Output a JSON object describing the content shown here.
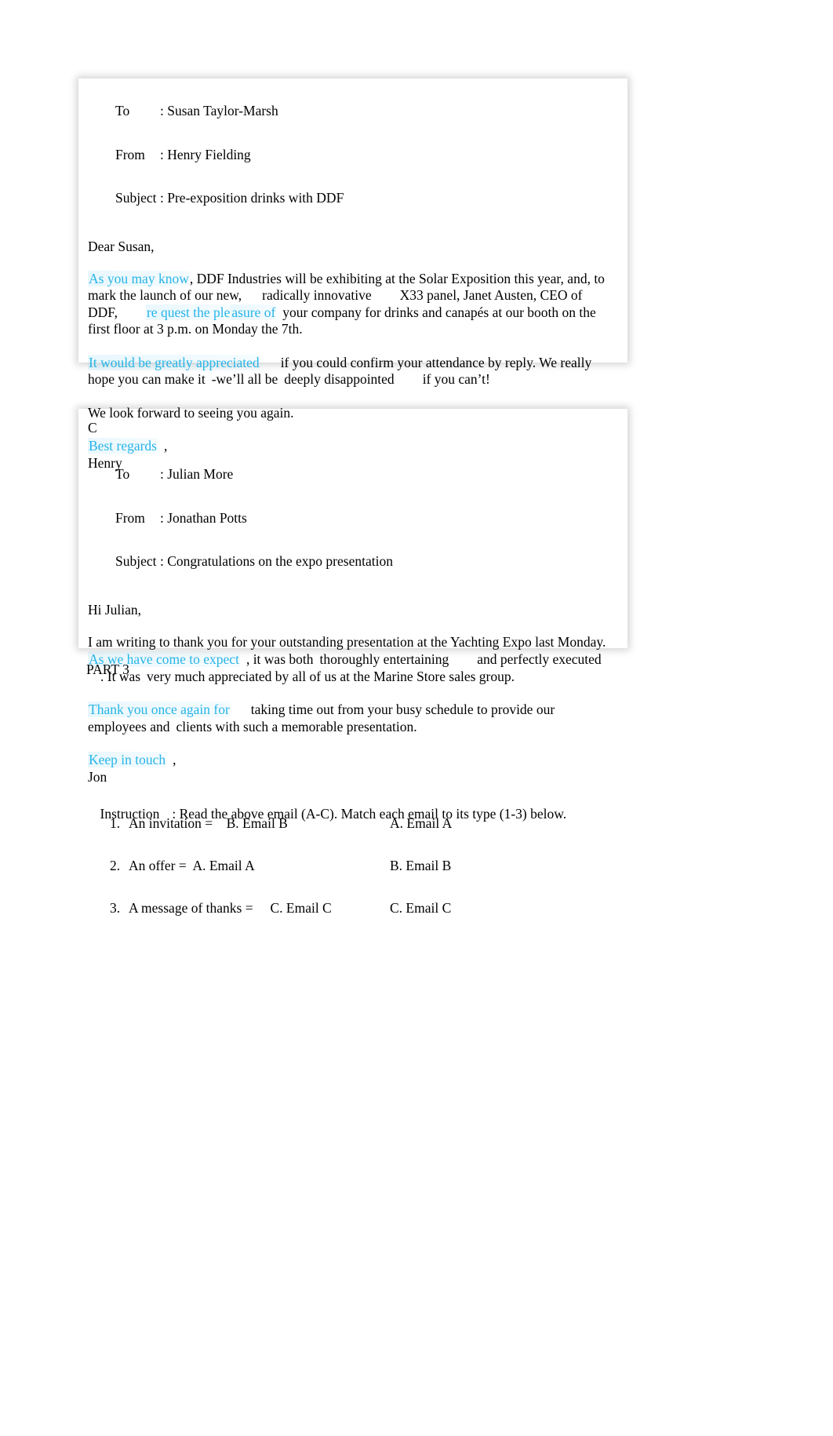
{
  "document": {
    "part_label": "PART 3",
    "instruction_label": "Instruction",
    "instruction_text": ": Read the above email (A-C). Match each email to its type (1-3) below."
  },
  "accent_color": "#27b4e8",
  "emails": [
    {
      "letter": "",
      "headers": [
        {
          "label": "To",
          "value": ": Susan Taylor-Marsh"
        },
        {
          "label": "From",
          "value": ": Henry Fielding"
        },
        {
          "label": "Subject",
          "value": ": Pre-exposition drinks with DDF"
        }
      ],
      "salutation": "Dear Susan,",
      "body": {
        "p1_hl1": "As  you may know",
        "p1_t1": ", DDF Industries will be exhibiting at the Solar Exposition this year, and, to mark t",
        "p1_t2": "he launch of our new,",
        "p1_t3": "radically innovative",
        "p1_t4": "X33 panel, Janet Austen, CEO of DDF,",
        "p1_hl2": "re quest the ple",
        "p1_hl3": "asure of",
        "p1_t5": "your company for drinks and canapés at our booth on the first floor at 3 p.m. on Monday th",
        "p1_t6": "e 7th.",
        "p2_hl1": "It would be greatly appreciated",
        "p2_t1": "if you could confirm your attendance by reply. We really hope you c",
        "p2_t2": "an make it",
        "p2_t3": "-we’ll all be",
        "p2_t4": "deeply disappointed",
        "p2_t5": "if you can’t!",
        "p3_t1": "We look forward to seeing you again.",
        "sign_hl": "Best regards",
        "sign_comma": ",",
        "sign_name": "Henry"
      }
    },
    {
      "letter": "C",
      "headers": [
        {
          "label": "To",
          "value": ": Julian More"
        },
        {
          "label": "From",
          "value": ": Jonathan Potts"
        },
        {
          "label": "Subject",
          "value": ": Congratulations on the expo presentation"
        }
      ],
      "salutation": "Hi Julian,",
      "body": {
        "p1_t0": "I am writing to thank you for your outstanding presentation at the Yachting Expo last Monday.",
        "p1_hl1": "As we have come to expect",
        "p1_t1": ", it was both",
        "p1_t2": "thoroughly entertaining",
        "p1_t3": "and  perfectly executed",
        "p1_t4": ". It was",
        "p1_t5": "very much appreciated by all of us at the Marine Store sales group.",
        "p2_hl1": "Thank you once again for",
        "p2_t1": "taking time out from your busy schedule to provide our employees and",
        "p2_t2": "clients with such a memorable presentation.",
        "sign_hl": "Keep in touch",
        "sign_comma": ",",
        "sign_name": "Jon"
      }
    }
  ],
  "answers": [
    {
      "num": "1.",
      "text": "An invitation =    B. Email B",
      "option": "A. Email A"
    },
    {
      "num": "2.",
      "text": "An offer =  A. Email A",
      "option": "B. Email B"
    },
    {
      "num": "3.",
      "text": "A message of thanks =     C. Email C",
      "option": "C. Email C"
    }
  ]
}
